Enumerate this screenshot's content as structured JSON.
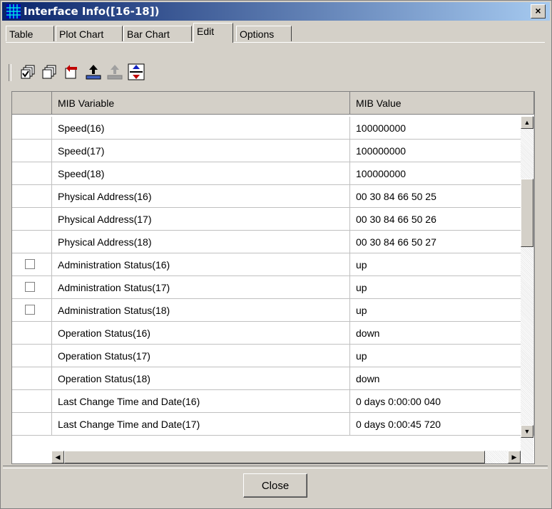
{
  "window": {
    "title": "Interface Info([16-18])",
    "close_glyph": "×"
  },
  "tabs": [
    {
      "label": "Table",
      "active": false
    },
    {
      "label": "Plot Chart",
      "active": false
    },
    {
      "label": "Bar Chart",
      "active": false
    },
    {
      "label": "Edit",
      "active": true
    },
    {
      "label": "Options",
      "active": false
    }
  ],
  "toolbar": {
    "icons": [
      "select-all-icon",
      "deselect-all-icon",
      "undo-icon",
      "upload-icon",
      "upload-disabled-icon",
      "refresh-icon"
    ]
  },
  "table": {
    "headers": {
      "check": "",
      "variable": "MIB Variable",
      "value": "MIB Value"
    },
    "rows": [
      {
        "checkbox": false,
        "variable": "Speed(16)",
        "value": "100000000"
      },
      {
        "checkbox": false,
        "variable": "Speed(17)",
        "value": "100000000"
      },
      {
        "checkbox": false,
        "variable": "Speed(18)",
        "value": "100000000"
      },
      {
        "checkbox": false,
        "variable": "Physical Address(16)",
        "value": "00 30 84 66 50 25"
      },
      {
        "checkbox": false,
        "variable": "Physical Address(17)",
        "value": "00 30 84 66 50 26"
      },
      {
        "checkbox": false,
        "variable": "Physical Address(18)",
        "value": "00 30 84 66 50 27"
      },
      {
        "checkbox": true,
        "variable": "Administration Status(16)",
        "value": "up"
      },
      {
        "checkbox": true,
        "variable": "Administration Status(17)",
        "value": "up"
      },
      {
        "checkbox": true,
        "variable": "Administration Status(18)",
        "value": "up"
      },
      {
        "checkbox": false,
        "variable": "Operation Status(16)",
        "value": "down"
      },
      {
        "checkbox": false,
        "variable": "Operation Status(17)",
        "value": "up"
      },
      {
        "checkbox": false,
        "variable": "Operation Status(18)",
        "value": "down"
      },
      {
        "checkbox": false,
        "variable": "Last Change Time and Date(16)",
        "value": "0 days 0:00:00 040"
      },
      {
        "checkbox": false,
        "variable": "Last Change Time and Date(17)",
        "value": "0 days 0:00:45 720"
      }
    ]
  },
  "footer": {
    "close_label": "Close"
  }
}
